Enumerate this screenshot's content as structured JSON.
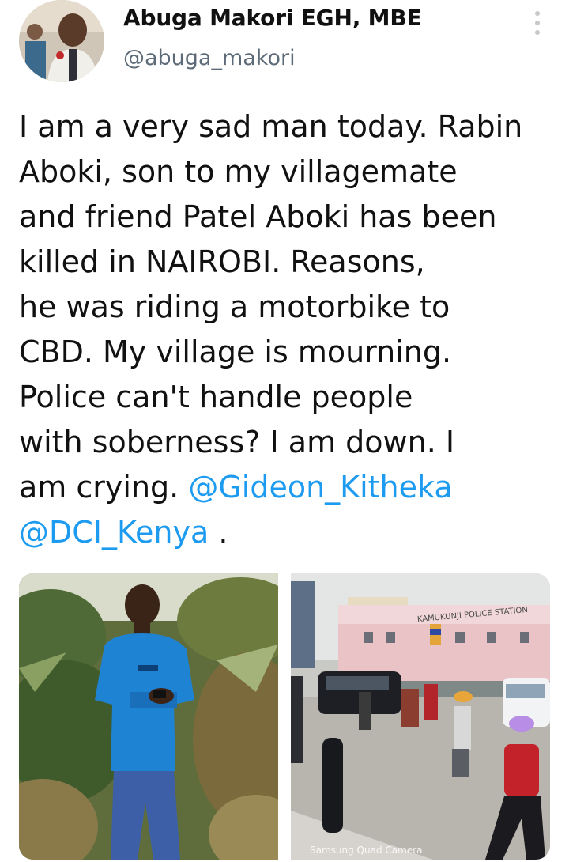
{
  "author": {
    "display_name": "Abuga Makori EGH, MBE",
    "handle": "@abuga_makori",
    "avatar_icon": "profile-photo"
  },
  "menu": {
    "icon": "more-vertical-icon"
  },
  "tweet": {
    "lines": [
      "I am a very sad man today. Rabin",
      "Aboki, son to my villagemate",
      "and friend Patel Aboki has been",
      "killed in NAIROBI. Reasons,",
      "he was riding a motorbike to",
      "CBD. My village is mourning.",
      "Police can't handle people",
      "with soberness? I am down. I"
    ],
    "line9_prefix": "am crying. ",
    "mention_1": "@Gideon_Kitheka",
    "mention_2": "@DCI_Kenya",
    "line10_suffix": " ."
  },
  "media": {
    "photo_1": "photo-young-man-blue-shirt",
    "photo_2": "photo-kamukunji-police-station",
    "sign_text": "KAMUKUNJI POLICE STATION",
    "camera_watermark": "Samsung Quad Camera"
  },
  "colors": {
    "link": "#1d9bf0",
    "handle": "#5d6b78",
    "text": "#111111"
  }
}
